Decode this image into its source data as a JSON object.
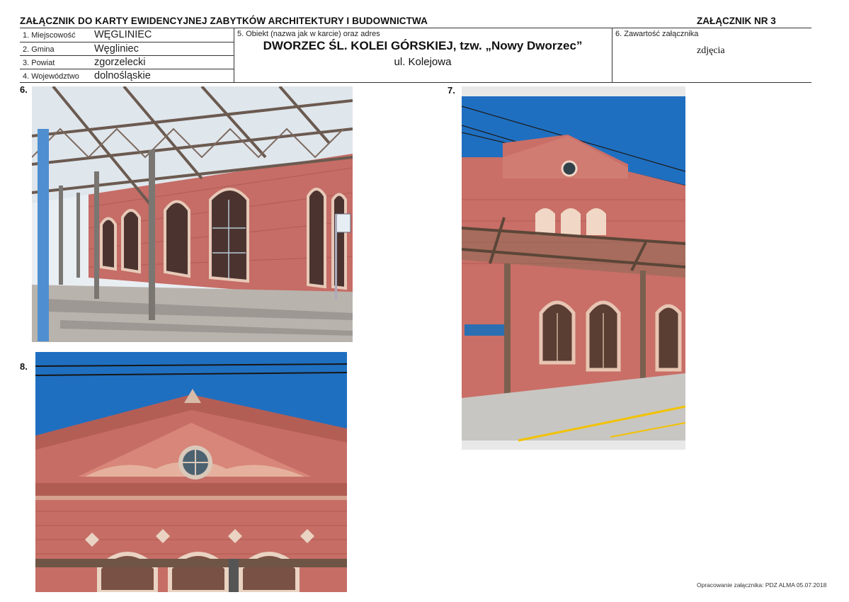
{
  "header": {
    "title": "ZAŁĄCZNIK DO KARTY EWIDENCYJNEJ ZABYTKÓW ARCHITEKTURY I BUDOWNICTWA",
    "attachment_no": "ZAŁĄCZNIK NR 3"
  },
  "location": {
    "rows": [
      {
        "label": "1. Miejscowość",
        "value": "WĘGLINIEC"
      },
      {
        "label": "2. Gmina",
        "value": "Węgliniec"
      },
      {
        "label": "3. Powiat",
        "value": "zgorzelecki"
      },
      {
        "label": "4. Województwo",
        "value": "dolnośląskie"
      }
    ]
  },
  "object": {
    "label": "5. Obiekt (nazwa jak w karcie) oraz adres",
    "name": "DWORZEC ŚL. KOLEI GÓRSKIEJ, tzw. „Nowy Dworzec”",
    "address": "ul. Kolejowa"
  },
  "contents": {
    "label": "6. Zawartość załącznika",
    "value": "zdjęcia"
  },
  "photos": [
    {
      "number": "6.",
      "icon": "platform-canopy-photo"
    },
    {
      "number": "7.",
      "icon": "station-facade-photo"
    },
    {
      "number": "8.",
      "icon": "gable-detail-photo"
    }
  ],
  "footer": {
    "text": "Opracowanie załącznika: PDZ ALMA 05.07.2018"
  },
  "colors": {
    "brick": "#c9706a",
    "sky": "#1f6fc0",
    "steel": "#6b5a50"
  }
}
